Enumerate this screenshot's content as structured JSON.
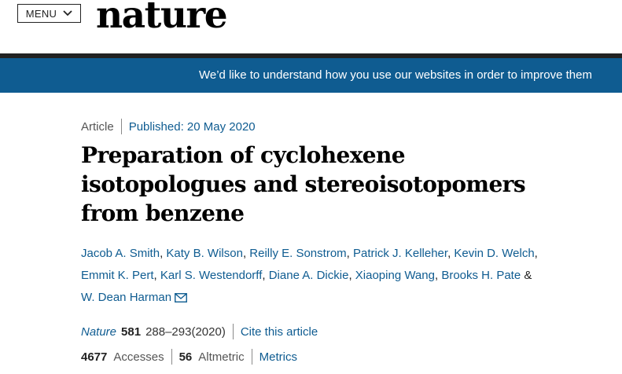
{
  "header": {
    "menu_label": "MENU",
    "logo": "nature"
  },
  "banner": {
    "text": "We’d like to understand how you use our websites in order to improve them"
  },
  "article": {
    "type": "Article",
    "published": "Published: 20 May 2020",
    "title": "Preparation of cyclohexene isotopologues and stereoisotopomers from benzene",
    "authors": [
      "Jacob A. Smith",
      "Katy B. Wilson",
      "Reilly E. Sonstrom",
      "Patrick J. Kelleher",
      "Kevin D. Welch",
      "Emmit K. Pert",
      "Karl S. Westendorff",
      "Diane A. Dickie",
      "Xiaoping Wang",
      "Brooks H. Pate",
      "W. Dean Harman"
    ],
    "author_separator": ",",
    "author_last_joiner": "&",
    "contact_icon": "mail-icon"
  },
  "citation": {
    "journal": "Nature",
    "volume": "581",
    "pages": "288–293(2020)",
    "cite_link": "Cite this article"
  },
  "metrics": {
    "accesses_count": "4677",
    "accesses_label": "Accesses",
    "altmetric_count": "56",
    "altmetric_label": "Altmetric",
    "metrics_link": "Metrics"
  },
  "colors": {
    "link": "#0f5c91",
    "banner": "#0f5c91",
    "divider": "#222222"
  }
}
